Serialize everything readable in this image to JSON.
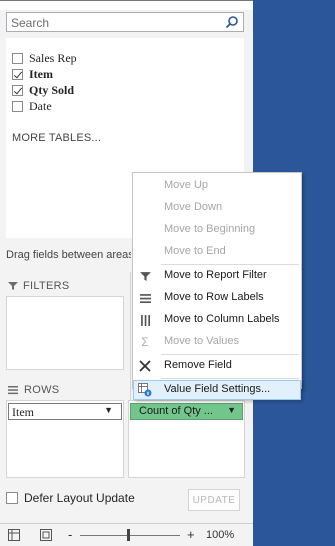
{
  "search": {
    "placeholder": "Search"
  },
  "fields": [
    {
      "label": "Sales Rep",
      "checked": false
    },
    {
      "label": "Item",
      "checked": true
    },
    {
      "label": "Qty Sold",
      "checked": true
    },
    {
      "label": "Date",
      "checked": false
    }
  ],
  "more_tables": "MORE TABLES...",
  "drag_hint": "Drag fields between areas below:",
  "areas": {
    "filters_label": "FILTERS",
    "rows_label": "ROWS"
  },
  "rows_item": {
    "label": "Item",
    "arrow": "▼"
  },
  "values_item": {
    "label": "Count of Qty ...",
    "arrow": "▼"
  },
  "defer": {
    "label": "Defer Layout Update",
    "checked": false
  },
  "update_button": "UPDATE",
  "zoom": {
    "percent": "100%",
    "minus": "-",
    "plus": "+"
  },
  "context_menu": {
    "items": [
      {
        "label": "Move Up",
        "enabled": false,
        "icon": "none"
      },
      {
        "label": "Move Down",
        "enabled": false,
        "icon": "none"
      },
      {
        "label": "Move to Beginning",
        "enabled": false,
        "icon": "none"
      },
      {
        "label": "Move to End",
        "enabled": false,
        "icon": "none"
      },
      {
        "label": "Move to Report Filter",
        "enabled": true,
        "icon": "filter-icon"
      },
      {
        "label": "Move to Row Labels",
        "enabled": true,
        "icon": "rows-icon"
      },
      {
        "label": "Move to Column Labels",
        "enabled": true,
        "icon": "columns-icon"
      },
      {
        "label": "Move to Values",
        "enabled": false,
        "icon": "sigma-icon"
      },
      {
        "label": "Remove Field",
        "enabled": true,
        "icon": "remove-x-icon"
      },
      {
        "label": "Value Field Settings...",
        "enabled": true,
        "icon": "value-settings-icon",
        "highlighted": true
      }
    ]
  },
  "colors": {
    "accent_blue": "#2b579a",
    "values_green": "#72c68b",
    "hover_blue": "#e1f0fa"
  }
}
